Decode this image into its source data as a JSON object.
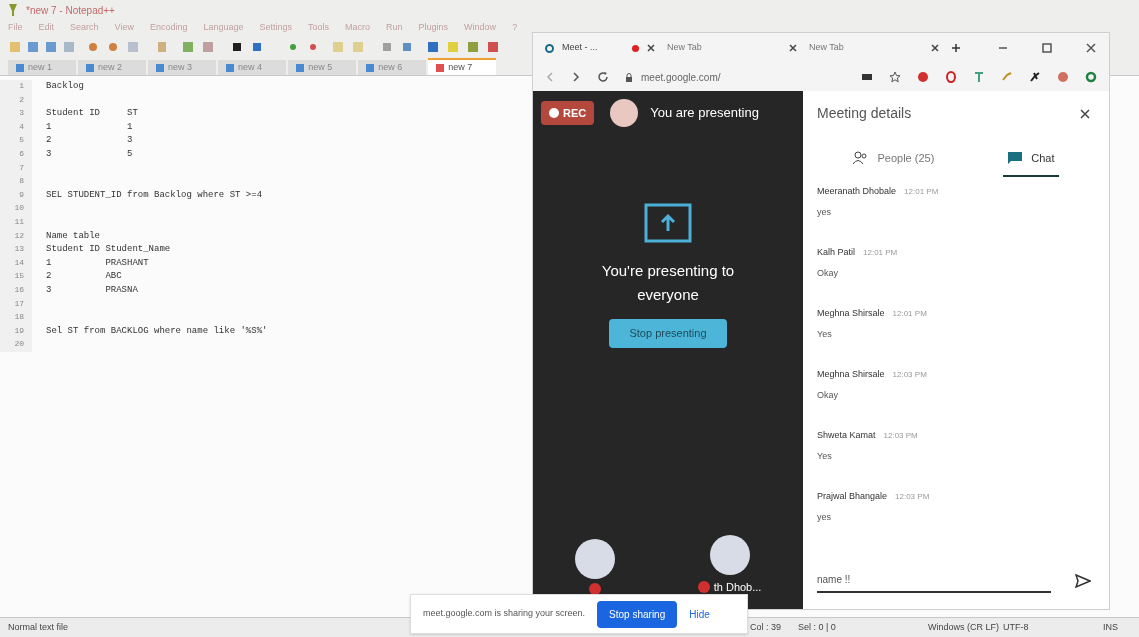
{
  "editor": {
    "title": "*new 7 - Notepad++",
    "menu": [
      "File",
      "Edit",
      "Search",
      "View",
      "Encoding",
      "Language",
      "Settings",
      "Tools",
      "Macro",
      "Run",
      "Plugins",
      "Window",
      "?"
    ],
    "tabs": [
      {
        "label": "new 1",
        "selected": false
      },
      {
        "label": "new 2",
        "selected": false
      },
      {
        "label": "new 3",
        "selected": false
      },
      {
        "label": "new 4",
        "selected": false
      },
      {
        "label": "new 5",
        "selected": false
      },
      {
        "label": "new 6",
        "selected": false
      },
      {
        "label": "new 7",
        "selected": true
      }
    ],
    "lines": [
      {
        "number": "1",
        "text": "Backlog"
      },
      {
        "number": "2"
      },
      {
        "number": "3",
        "text": "Student ID     ST"
      },
      {
        "number": "4",
        "text": "1              1"
      },
      {
        "number": "5",
        "text": "2              3"
      },
      {
        "number": "6",
        "text": "3              5"
      },
      {
        "number": "7"
      },
      {
        "number": "8"
      },
      {
        "number": "9",
        "text": "SEL STUDENT_ID from Backlog where ST >=4"
      },
      {
        "number": "10"
      },
      {
        "number": "11"
      },
      {
        "number": "12",
        "text": "Name table"
      },
      {
        "number": "13",
        "text": "Student ID Student_Name"
      },
      {
        "number": "14",
        "text": "1          PRASHANT"
      },
      {
        "number": "15",
        "text": "2          ABC"
      },
      {
        "number": "16",
        "text": "3          PRASNA"
      },
      {
        "number": "17"
      },
      {
        "number": "18"
      },
      {
        "number": "19",
        "text": "Sel ST from BACKLOG where name like '%S%'"
      },
      {
        "number": "20"
      }
    ]
  },
  "status_bar": {
    "file_type": "Normal text file",
    "position": "Col : 39",
    "selection": "Sel : 0 | 0",
    "eol": "Windows (CR LF)",
    "encoding": "UTF-8",
    "mode": "INS"
  },
  "browser": {
    "tabs": [
      {
        "label": "Meet - ...",
        "recording": true,
        "selected": true
      },
      {
        "label": "New Tab",
        "recording": false,
        "selected": false
      },
      {
        "label": "New Tab",
        "recording": false,
        "selected": false
      }
    ],
    "address": "meet.google.com/"
  },
  "meet": {
    "rec": "REC",
    "presenter_label": "You are presenting",
    "message": "You're presenting to everyone",
    "stop_button": "Stop presenting",
    "tiles": [
      {
        "muted": true
      },
      {
        "muted": true,
        "name": "th Dhob..."
      }
    ]
  },
  "details": {
    "title": "Meeting details",
    "tabs": [
      {
        "label": "People (25)",
        "kind": "people",
        "selected": false
      },
      {
        "label": "Chat",
        "kind": "chat",
        "selected": true
      }
    ],
    "messages": [
      {
        "sender": "Meeranath Dhobale",
        "time": "12:01 PM",
        "text": "yes"
      },
      {
        "sender": "Kalh Patil",
        "time": "12:01 PM",
        "text": "Okay"
      },
      {
        "sender": "Meghna Shirsale",
        "time": "12:01 PM",
        "text": "Yes"
      },
      {
        "sender": "Meghna Shirsale",
        "time": "12:03 PM",
        "text": "Okay"
      },
      {
        "sender": "Shweta Kamat",
        "time": "12:03 PM",
        "text": "Yes"
      },
      {
        "sender": "Prajwal Bhangale",
        "time": "12:03 PM",
        "text": "yes"
      }
    ],
    "input_value": "name !!"
  },
  "share_bar": {
    "message": "meet.google.com is sharing your screen.",
    "stop_button": "Stop sharing",
    "hide_button": "Hide"
  }
}
